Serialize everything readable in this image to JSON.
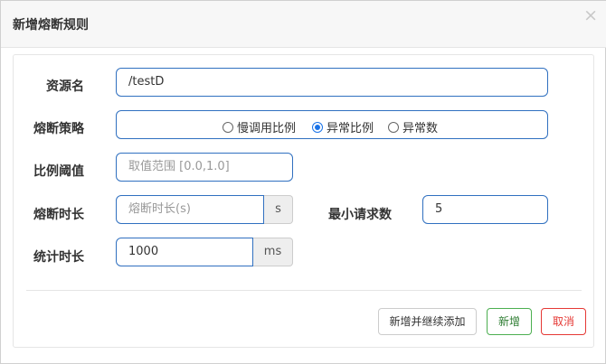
{
  "dialog": {
    "title": "新增熔断规则",
    "close": "×"
  },
  "form": {
    "resource": {
      "label": "资源名",
      "value": "/testD"
    },
    "strategy": {
      "label": "熔断策略",
      "options": [
        {
          "label": "慢调用比例",
          "checked": false
        },
        {
          "label": "异常比例",
          "checked": true
        },
        {
          "label": "异常数",
          "checked": false
        }
      ]
    },
    "ratio": {
      "label": "比例阈值",
      "placeholder": "取值范围 [0.0,1.0]"
    },
    "duration": {
      "label": "熔断时长",
      "placeholder": "熔断时长(s)",
      "unit": "s"
    },
    "min_requests": {
      "label": "最小请求数",
      "value": "5"
    },
    "stat_window": {
      "label": "统计时长",
      "value": "1000",
      "unit": "ms"
    }
  },
  "buttons": {
    "add_continue": "新增并继续添加",
    "add": "新增",
    "cancel": "取消"
  },
  "colors": {
    "accent_border": "#3070c0",
    "success": "#4caf50",
    "danger": "#e53935"
  }
}
